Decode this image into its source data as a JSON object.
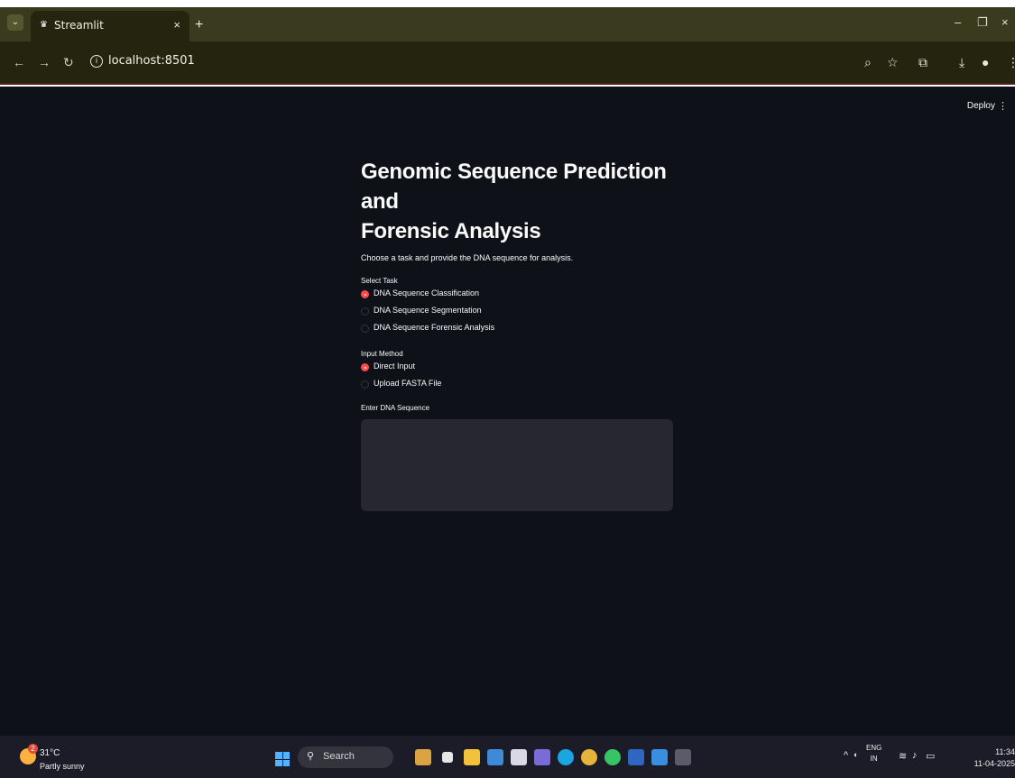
{
  "browser": {
    "tab_title": "Streamlit",
    "url": "localhost:8501"
  },
  "app": {
    "deploy_label": "Deploy",
    "title_line1": "Genomic Sequence Prediction and",
    "title_line2": "Forensic Analysis",
    "subtitle": "Choose a task and provide the DNA sequence for analysis.",
    "task_label": "Select Task",
    "tasks": [
      {
        "label": "DNA Sequence Classification",
        "selected": true
      },
      {
        "label": "DNA Sequence Segmentation",
        "selected": false
      },
      {
        "label": "DNA Sequence Forensic Analysis",
        "selected": false
      }
    ],
    "input_method_label": "Input Method",
    "input_methods": [
      {
        "label": "Direct Input",
        "selected": true
      },
      {
        "label": "Upload FASTA File",
        "selected": false
      }
    ],
    "sequence_label": "Enter DNA Sequence",
    "sequence_value": "",
    "accent_color": "#ff4b4b",
    "background_color": "#0e1117"
  },
  "taskbar": {
    "weather_badge": "2",
    "temperature": "31°C",
    "condition": "Partly sunny",
    "search_label": "Search",
    "lang_top": "ENG",
    "lang_bottom": "IN",
    "time": "11:34",
    "date": "11-04-2025"
  }
}
